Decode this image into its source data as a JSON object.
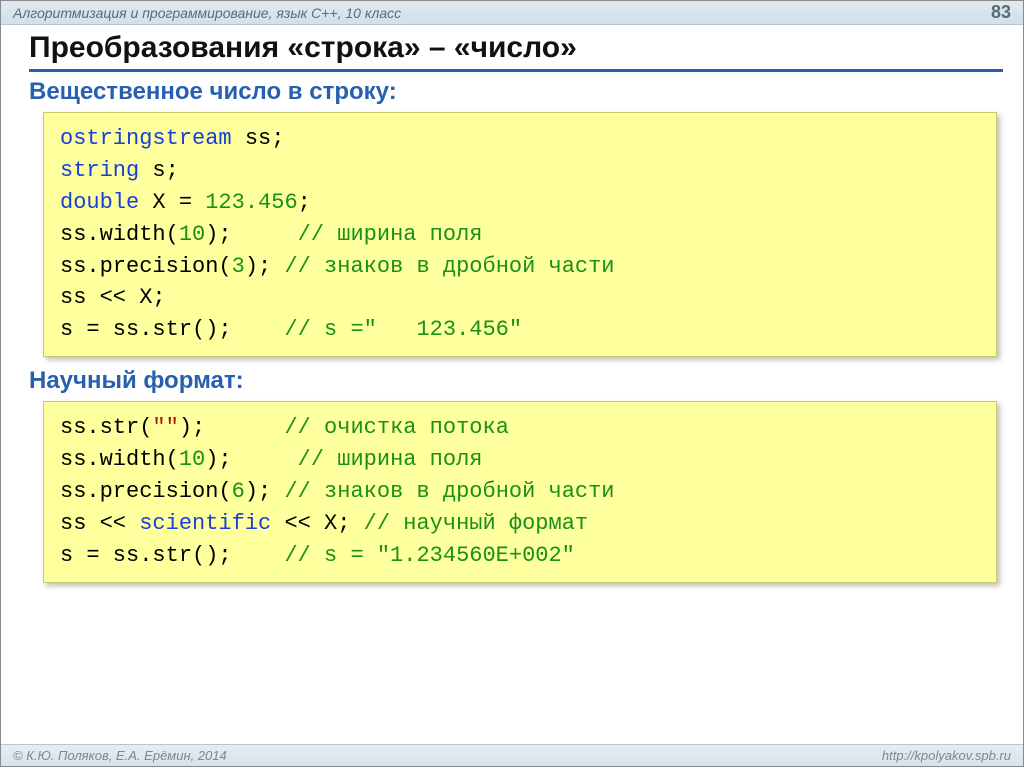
{
  "header": {
    "course": "Алгоритмизация и программирование, язык C++, 10 класс",
    "page": "83"
  },
  "title": "Преобразования «строка» – «число»",
  "section1": {
    "heading": "Вещественное число в строку:",
    "code": {
      "l1a": "ostringstream",
      "l1b": " ss;",
      "l2a": "string",
      "l2b": " s;",
      "l3a": "double",
      "l3b": " X = ",
      "l3c": "123.456",
      "l3d": ";",
      "l4a": "ss.width(",
      "l4b": "10",
      "l4c": ");     ",
      "l4d": "// ширина поля",
      "l5a": "ss.precision(",
      "l5b": "3",
      "l5c": "); ",
      "l5d": "// знаков в дробной части",
      "l6": "ss << X;",
      "l7a": "s = ss.str();    ",
      "l7b": "// s =\"   123.456\""
    }
  },
  "section2": {
    "heading": "Научный формат:",
    "code": {
      "l1a": "ss.str(",
      "l1b": "\"\"",
      "l1c": ");      ",
      "l1d": "// очистка потока",
      "l2a": "ss.width(",
      "l2b": "10",
      "l2c": ");     ",
      "l2d": "// ширина поля",
      "l3a": "ss.precision(",
      "l3b": "6",
      "l3c": "); ",
      "l3d": "// знаков в дробной части",
      "l4a": "ss << ",
      "l4b": "scientific",
      "l4c": " << X; ",
      "l4d": "// научный формат",
      "l5a": "s = ss.str();    ",
      "l5b": "// s = \"1.234560E+002\""
    }
  },
  "footer": {
    "copyright": "© К.Ю. Поляков, Е.А. Ерёмин, 2014",
    "url": "http://kpolyakov.spb.ru"
  }
}
